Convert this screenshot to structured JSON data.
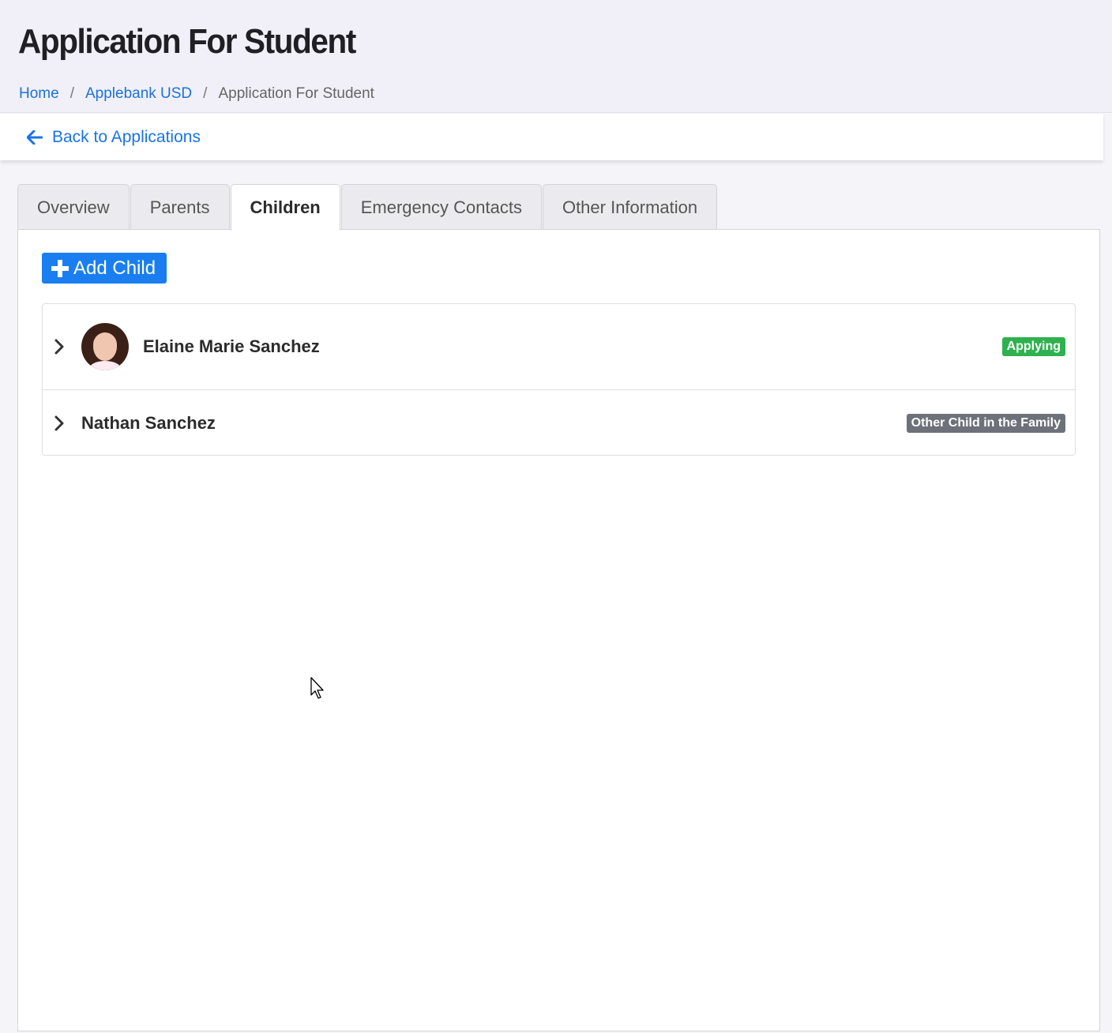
{
  "header": {
    "title": "Application For Student",
    "breadcrumb": {
      "home": "Home",
      "district": "Applebank USD",
      "current": "Application For Student",
      "separator": "/"
    }
  },
  "back_link": {
    "label": "Back to Applications",
    "icon": "arrow-left-icon"
  },
  "tabs": [
    {
      "label": "Overview",
      "active": false
    },
    {
      "label": "Parents",
      "active": false
    },
    {
      "label": "Children",
      "active": true
    },
    {
      "label": "Emergency Contacts",
      "active": false
    },
    {
      "label": "Other Information",
      "active": false
    }
  ],
  "children_panel": {
    "add_button": {
      "label": "Add Child",
      "icon": "plus-icon"
    },
    "children": [
      {
        "name": "Elaine Marie Sanchez",
        "has_photo": true,
        "status": "Applying",
        "status_color": "#2fb14f"
      },
      {
        "name": "Nathan Sanchez",
        "has_photo": false,
        "status": "Other Child in the Family",
        "status_color": "#6c717a"
      }
    ]
  },
  "colors": {
    "accent": "#1a7ef0",
    "link": "#1a73e8",
    "header_bg": "#f1eff7"
  }
}
